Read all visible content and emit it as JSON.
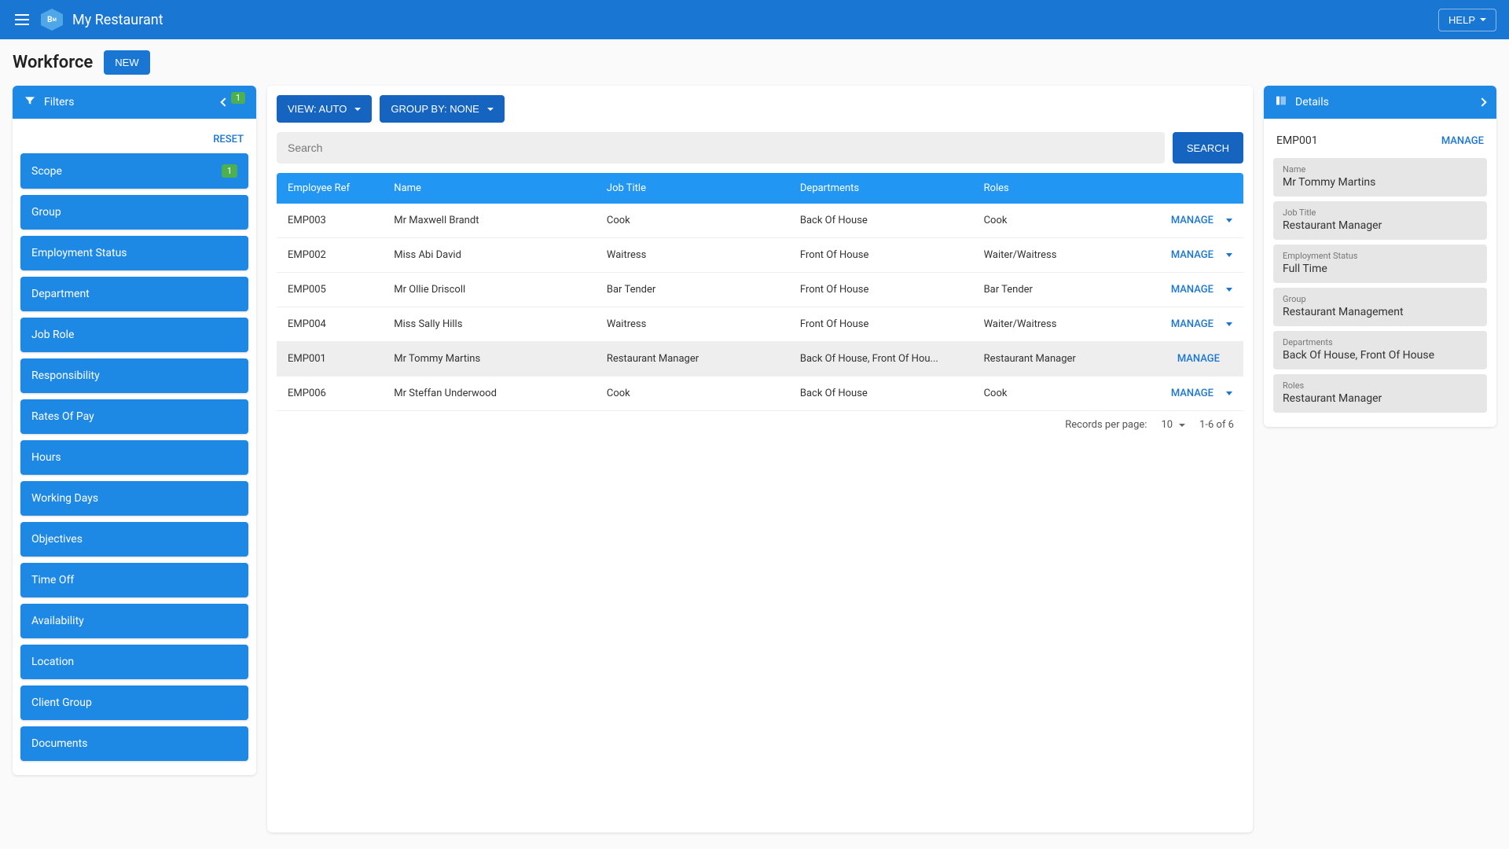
{
  "topbar": {
    "app_title": "My Restaurant",
    "help_label": "HELP"
  },
  "page": {
    "title": "Workforce",
    "new_label": "NEW"
  },
  "filters": {
    "header_label": "Filters",
    "header_badge": "1",
    "reset_label": "RESET",
    "items": [
      {
        "label": "Scope",
        "badge": "1"
      },
      {
        "label": "Group"
      },
      {
        "label": "Employment Status"
      },
      {
        "label": "Department"
      },
      {
        "label": "Job Role"
      },
      {
        "label": "Responsibility"
      },
      {
        "label": "Rates Of Pay"
      },
      {
        "label": "Hours"
      },
      {
        "label": "Working Days"
      },
      {
        "label": "Objectives"
      },
      {
        "label": "Time Off"
      },
      {
        "label": "Availability"
      },
      {
        "label": "Location"
      },
      {
        "label": "Client Group"
      },
      {
        "label": "Documents"
      }
    ]
  },
  "toolbar": {
    "view_label": "VIEW: AUTO",
    "group_label": "GROUP BY: NONE"
  },
  "search": {
    "placeholder": "Search",
    "button_label": "SEARCH"
  },
  "table": {
    "columns": [
      "Employee Ref",
      "Name",
      "Job Title",
      "Departments",
      "Roles"
    ],
    "manage_label": "MANAGE",
    "rows": [
      {
        "ref": "EMP003",
        "name": "Mr Maxwell Brandt",
        "job": "Cook",
        "dept": "Back Of House",
        "roles": "Cook",
        "has_menu": true
      },
      {
        "ref": "EMP002",
        "name": "Miss Abi David",
        "job": "Waitress",
        "dept": "Front Of House",
        "roles": "Waiter/Waitress",
        "has_menu": true
      },
      {
        "ref": "EMP005",
        "name": "Mr Ollie Driscoll",
        "job": "Bar Tender",
        "dept": "Front Of House",
        "roles": "Bar Tender",
        "has_menu": true
      },
      {
        "ref": "EMP004",
        "name": "Miss Sally Hills",
        "job": "Waitress",
        "dept": "Front Of House",
        "roles": "Waiter/Waitress",
        "has_menu": true
      },
      {
        "ref": "EMP001",
        "name": "Mr Tommy Martins",
        "job": "Restaurant Manager",
        "dept": "Back Of House, Front Of Hou...",
        "roles": "Restaurant Manager",
        "selected": true,
        "has_menu": false
      },
      {
        "ref": "EMP006",
        "name": "Mr Steffan Underwood",
        "job": "Cook",
        "dept": "Back Of House",
        "roles": "Cook",
        "has_menu": true
      }
    ]
  },
  "pager": {
    "records_label": "Records per page:",
    "page_size": "10",
    "range_label": "1-6 of 6"
  },
  "details": {
    "header_label": "Details",
    "id": "EMP001",
    "manage_label": "MANAGE",
    "fields": [
      {
        "label": "Name",
        "value": "Mr Tommy Martins"
      },
      {
        "label": "Job Title",
        "value": "Restaurant Manager"
      },
      {
        "label": "Employment Status",
        "value": "Full Time"
      },
      {
        "label": "Group",
        "value": "Restaurant Management"
      },
      {
        "label": "Departments",
        "value": "Back Of House, Front Of House"
      },
      {
        "label": "Roles",
        "value": "Restaurant Manager"
      }
    ]
  }
}
